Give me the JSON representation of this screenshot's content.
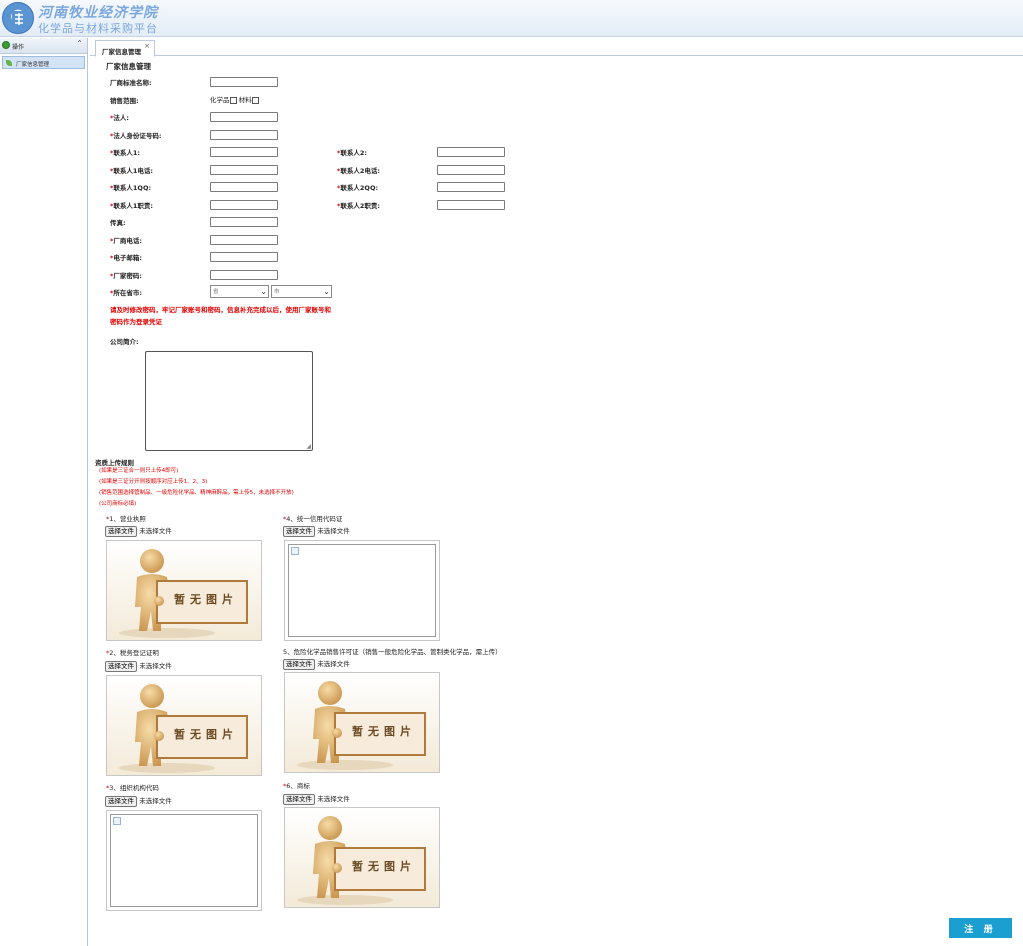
{
  "header": {
    "school_name": "河南牧业经济学院",
    "platform_name": "化学品与材料采购平台"
  },
  "sidebar": {
    "section_label": "操作",
    "items": [
      {
        "label": "厂家信息管理"
      }
    ]
  },
  "tabs": [
    {
      "label": "厂家信息管理"
    }
  ],
  "form": {
    "title": "厂家信息管理",
    "fields": {
      "name": "厂商标准名称:",
      "scope": "销售范围:",
      "scope_opt1": "化学品",
      "scope_opt2": "材料",
      "legal": "法人:",
      "legal_id": "法人身份证号码:",
      "c1": "联系人1:",
      "c2": "联系人2:",
      "c1_phone": "联系人1电话:",
      "c2_phone": "联系人2电话:",
      "c1_qq": "联系人1QQ:",
      "c2_qq": "联系人2QQ:",
      "c1_duty": "联系人1职责:",
      "c2_duty": "联系人2职责:",
      "fax": "传真:",
      "phone": "厂商电话:",
      "email": "电子邮箱:",
      "password": "厂家密码:",
      "city": "所在省市:",
      "intro": "公司简介:"
    },
    "province_placeholder": "省",
    "city_placeholder": "市",
    "warning": "请及时修改密码，牢记厂家账号和密码，信息补充完成以后，使用厂家账号和密码作为登录凭证"
  },
  "upload": {
    "title": "资质上传规则",
    "rules": [
      "(如果是三证合一则只上传4即可)",
      "(如果是三证分开则按顺序对应上传1、2、3)",
      "(销售范围选择管制品、一级危险化学品、精神麻醉品，需上传5，未选择不开放)",
      "(公司商标必填)"
    ],
    "items": [
      {
        "label": "1、营业执照",
        "required": true
      },
      {
        "label": "2、税务登记证明",
        "required": true
      },
      {
        "label": "3、组织机构代码",
        "required": true
      },
      {
        "label": "4、统一信用代码证",
        "required": true
      },
      {
        "label": "5、危险化学品销售许可证（销售一般危险化学品、管制类化学品，需上传）",
        "required": false
      },
      {
        "label": "6、商标",
        "required": true
      }
    ],
    "choose_label": "选择文件",
    "no_file_label": "未选择文件",
    "placeholder_text": "暂无图片"
  },
  "submit_label": "注 册",
  "colors": {
    "accent": "#1a9fd0",
    "required": "#d20000",
    "header_text": "#7aa8de"
  }
}
